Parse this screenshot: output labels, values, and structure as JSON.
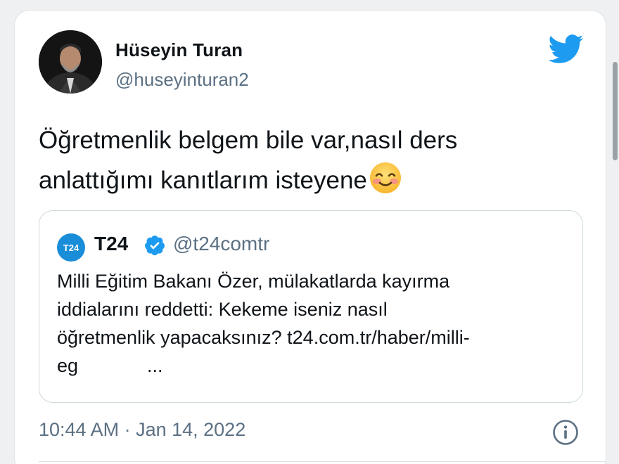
{
  "tweet": {
    "author_name": "Hüseyin Turan",
    "author_handle": "@huseyinturan2",
    "text": "Öğretmenlik belgem bile var,nasıl ders anlattığımı kanıtlarım isteyene",
    "emoji": "smiling-face-with-smiling-eyes",
    "timestamp": "10:44 AM · Jan 14, 2022",
    "brand_icon": "twitter-bird-icon",
    "brand_color": "#1d9bf0"
  },
  "quoted": {
    "avatar_text": "T24",
    "name": "T24",
    "verified": true,
    "handle": "@t24comtr",
    "lines": [
      "Milli Eğitim Bakanı Özer, mülakatlarda kayırma",
      "iddialarını reddetti: Kekeme iseniz nasıl",
      "öğretmenlik yapacaksınız? t24.com.tr/haber/milli-",
      "eg"
    ],
    "ellipsis": "...",
    "avatar_color": "#1a8dd8"
  }
}
